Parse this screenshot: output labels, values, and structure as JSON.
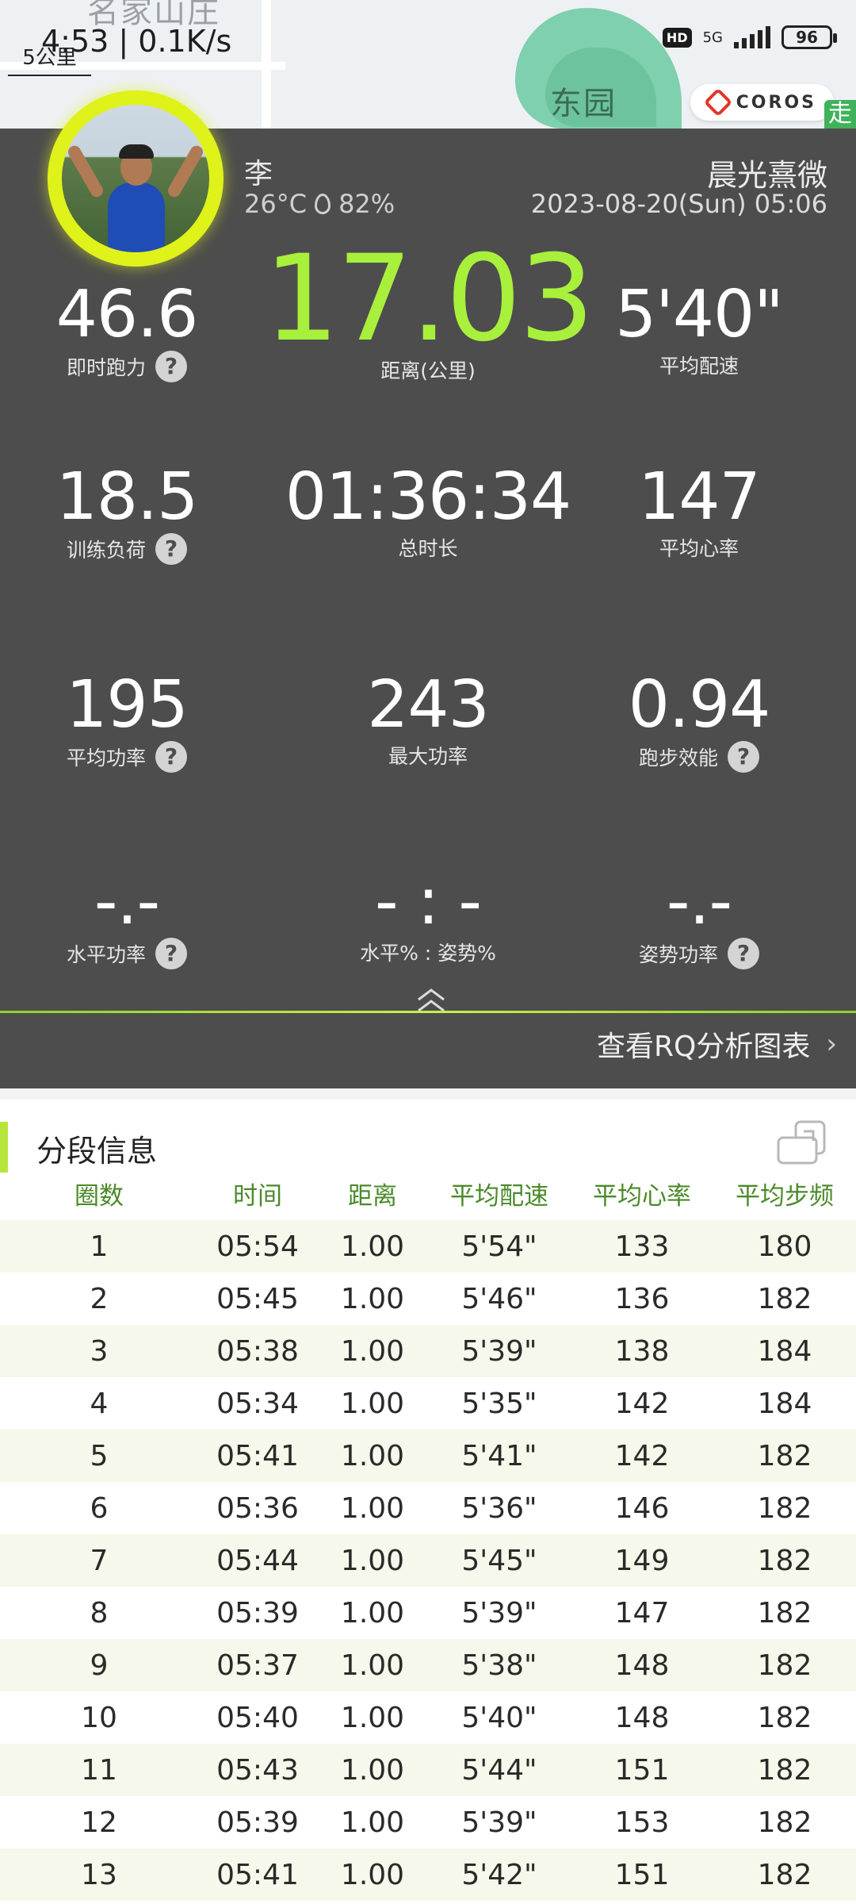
{
  "map": {
    "place_top": "名家山庄",
    "place_park": "东园",
    "scale_label": "5公里",
    "net_speed": "4:53 | 0.1K/s",
    "status": {
      "hd": "HD",
      "network": "5G",
      "battery": "96"
    },
    "brand": "COROS",
    "edge_icon": "走"
  },
  "colors": {
    "accent": "#a8f03c",
    "panel": "#4d4d4d",
    "ring": "#dff21a",
    "header_green": "#4b8a2a"
  },
  "user": {
    "name": "李",
    "temperature": "26°C",
    "humidity": "82%",
    "run_title": "晨光熹微",
    "datetime": "2023-08-20(Sun) 05:06"
  },
  "stats": {
    "running_power": {
      "value": "46.6",
      "label": "即时跑力"
    },
    "distance": {
      "value": "17.03",
      "label": "距离(公里)"
    },
    "avg_pace": {
      "value": "5'40\"",
      "label": "平均配速"
    },
    "training_load": {
      "value": "18.5",
      "label": "训练负荷"
    },
    "total_time": {
      "value": "01:36:34",
      "label": "总时长"
    },
    "avg_hr": {
      "value": "147",
      "label": "平均心率"
    },
    "avg_power": {
      "value": "195",
      "label": "平均功率"
    },
    "max_power": {
      "value": "243",
      "label": "最大功率"
    },
    "running_efficiency": {
      "value": "0.94",
      "label": "跑步效能"
    },
    "horizontal_power": {
      "value": "-.-",
      "label": "水平功率"
    },
    "horizontal_form": {
      "value": "- : -",
      "label": "水平% : 姿势%"
    },
    "form_power": {
      "value": "-.-",
      "label": "姿势功率"
    }
  },
  "rq_link": "查看RQ分析图表",
  "splits": {
    "title": "分段信息",
    "columns": [
      "圈数",
      "时间",
      "距离",
      "平均配速",
      "平均心率",
      "平均步频"
    ],
    "rows": [
      [
        "1",
        "05:54",
        "1.00",
        "5'54\"",
        "133",
        "180"
      ],
      [
        "2",
        "05:45",
        "1.00",
        "5'46\"",
        "136",
        "182"
      ],
      [
        "3",
        "05:38",
        "1.00",
        "5'39\"",
        "138",
        "184"
      ],
      [
        "4",
        "05:34",
        "1.00",
        "5'35\"",
        "142",
        "184"
      ],
      [
        "5",
        "05:41",
        "1.00",
        "5'41\"",
        "142",
        "182"
      ],
      [
        "6",
        "05:36",
        "1.00",
        "5'36\"",
        "146",
        "182"
      ],
      [
        "7",
        "05:44",
        "1.00",
        "5'45\"",
        "149",
        "182"
      ],
      [
        "8",
        "05:39",
        "1.00",
        "5'39\"",
        "147",
        "182"
      ],
      [
        "9",
        "05:37",
        "1.00",
        "5'38\"",
        "148",
        "182"
      ],
      [
        "10",
        "05:40",
        "1.00",
        "5'40\"",
        "148",
        "182"
      ],
      [
        "11",
        "05:43",
        "1.00",
        "5'44\"",
        "151",
        "182"
      ],
      [
        "12",
        "05:39",
        "1.00",
        "5'39\"",
        "153",
        "182"
      ],
      [
        "13",
        "05:41",
        "1.00",
        "5'42\"",
        "151",
        "182"
      ]
    ]
  }
}
